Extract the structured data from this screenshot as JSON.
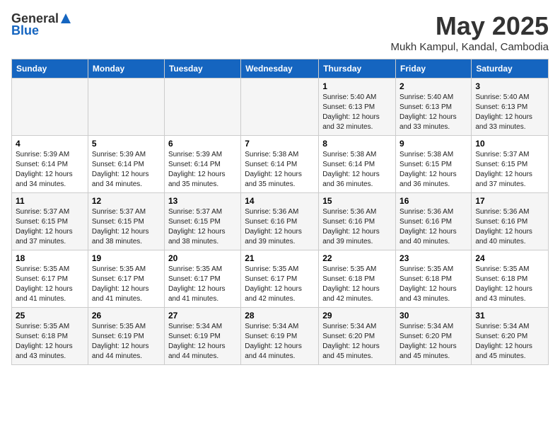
{
  "header": {
    "logo_general": "General",
    "logo_blue": "Blue",
    "month": "May 2025",
    "location": "Mukh Kampul, Kandal, Cambodia"
  },
  "weekdays": [
    "Sunday",
    "Monday",
    "Tuesday",
    "Wednesday",
    "Thursday",
    "Friday",
    "Saturday"
  ],
  "weeks": [
    [
      {
        "day": "",
        "sunrise": "",
        "sunset": "",
        "daylight": ""
      },
      {
        "day": "",
        "sunrise": "",
        "sunset": "",
        "daylight": ""
      },
      {
        "day": "",
        "sunrise": "",
        "sunset": "",
        "daylight": ""
      },
      {
        "day": "",
        "sunrise": "",
        "sunset": "",
        "daylight": ""
      },
      {
        "day": "1",
        "sunrise": "Sunrise: 5:40 AM",
        "sunset": "Sunset: 6:13 PM",
        "daylight": "Daylight: 12 hours and 32 minutes."
      },
      {
        "day": "2",
        "sunrise": "Sunrise: 5:40 AM",
        "sunset": "Sunset: 6:13 PM",
        "daylight": "Daylight: 12 hours and 33 minutes."
      },
      {
        "day": "3",
        "sunrise": "Sunrise: 5:40 AM",
        "sunset": "Sunset: 6:13 PM",
        "daylight": "Daylight: 12 hours and 33 minutes."
      }
    ],
    [
      {
        "day": "4",
        "sunrise": "Sunrise: 5:39 AM",
        "sunset": "Sunset: 6:14 PM",
        "daylight": "Daylight: 12 hours and 34 minutes."
      },
      {
        "day": "5",
        "sunrise": "Sunrise: 5:39 AM",
        "sunset": "Sunset: 6:14 PM",
        "daylight": "Daylight: 12 hours and 34 minutes."
      },
      {
        "day": "6",
        "sunrise": "Sunrise: 5:39 AM",
        "sunset": "Sunset: 6:14 PM",
        "daylight": "Daylight: 12 hours and 35 minutes."
      },
      {
        "day": "7",
        "sunrise": "Sunrise: 5:38 AM",
        "sunset": "Sunset: 6:14 PM",
        "daylight": "Daylight: 12 hours and 35 minutes."
      },
      {
        "day": "8",
        "sunrise": "Sunrise: 5:38 AM",
        "sunset": "Sunset: 6:14 PM",
        "daylight": "Daylight: 12 hours and 36 minutes."
      },
      {
        "day": "9",
        "sunrise": "Sunrise: 5:38 AM",
        "sunset": "Sunset: 6:15 PM",
        "daylight": "Daylight: 12 hours and 36 minutes."
      },
      {
        "day": "10",
        "sunrise": "Sunrise: 5:37 AM",
        "sunset": "Sunset: 6:15 PM",
        "daylight": "Daylight: 12 hours and 37 minutes."
      }
    ],
    [
      {
        "day": "11",
        "sunrise": "Sunrise: 5:37 AM",
        "sunset": "Sunset: 6:15 PM",
        "daylight": "Daylight: 12 hours and 37 minutes."
      },
      {
        "day": "12",
        "sunrise": "Sunrise: 5:37 AM",
        "sunset": "Sunset: 6:15 PM",
        "daylight": "Daylight: 12 hours and 38 minutes."
      },
      {
        "day": "13",
        "sunrise": "Sunrise: 5:37 AM",
        "sunset": "Sunset: 6:15 PM",
        "daylight": "Daylight: 12 hours and 38 minutes."
      },
      {
        "day": "14",
        "sunrise": "Sunrise: 5:36 AM",
        "sunset": "Sunset: 6:16 PM",
        "daylight": "Daylight: 12 hours and 39 minutes."
      },
      {
        "day": "15",
        "sunrise": "Sunrise: 5:36 AM",
        "sunset": "Sunset: 6:16 PM",
        "daylight": "Daylight: 12 hours and 39 minutes."
      },
      {
        "day": "16",
        "sunrise": "Sunrise: 5:36 AM",
        "sunset": "Sunset: 6:16 PM",
        "daylight": "Daylight: 12 hours and 40 minutes."
      },
      {
        "day": "17",
        "sunrise": "Sunrise: 5:36 AM",
        "sunset": "Sunset: 6:16 PM",
        "daylight": "Daylight: 12 hours and 40 minutes."
      }
    ],
    [
      {
        "day": "18",
        "sunrise": "Sunrise: 5:35 AM",
        "sunset": "Sunset: 6:17 PM",
        "daylight": "Daylight: 12 hours and 41 minutes."
      },
      {
        "day": "19",
        "sunrise": "Sunrise: 5:35 AM",
        "sunset": "Sunset: 6:17 PM",
        "daylight": "Daylight: 12 hours and 41 minutes."
      },
      {
        "day": "20",
        "sunrise": "Sunrise: 5:35 AM",
        "sunset": "Sunset: 6:17 PM",
        "daylight": "Daylight: 12 hours and 41 minutes."
      },
      {
        "day": "21",
        "sunrise": "Sunrise: 5:35 AM",
        "sunset": "Sunset: 6:17 PM",
        "daylight": "Daylight: 12 hours and 42 minutes."
      },
      {
        "day": "22",
        "sunrise": "Sunrise: 5:35 AM",
        "sunset": "Sunset: 6:18 PM",
        "daylight": "Daylight: 12 hours and 42 minutes."
      },
      {
        "day": "23",
        "sunrise": "Sunrise: 5:35 AM",
        "sunset": "Sunset: 6:18 PM",
        "daylight": "Daylight: 12 hours and 43 minutes."
      },
      {
        "day": "24",
        "sunrise": "Sunrise: 5:35 AM",
        "sunset": "Sunset: 6:18 PM",
        "daylight": "Daylight: 12 hours and 43 minutes."
      }
    ],
    [
      {
        "day": "25",
        "sunrise": "Sunrise: 5:35 AM",
        "sunset": "Sunset: 6:18 PM",
        "daylight": "Daylight: 12 hours and 43 minutes."
      },
      {
        "day": "26",
        "sunrise": "Sunrise: 5:35 AM",
        "sunset": "Sunset: 6:19 PM",
        "daylight": "Daylight: 12 hours and 44 minutes."
      },
      {
        "day": "27",
        "sunrise": "Sunrise: 5:34 AM",
        "sunset": "Sunset: 6:19 PM",
        "daylight": "Daylight: 12 hours and 44 minutes."
      },
      {
        "day": "28",
        "sunrise": "Sunrise: 5:34 AM",
        "sunset": "Sunset: 6:19 PM",
        "daylight": "Daylight: 12 hours and 44 minutes."
      },
      {
        "day": "29",
        "sunrise": "Sunrise: 5:34 AM",
        "sunset": "Sunset: 6:20 PM",
        "daylight": "Daylight: 12 hours and 45 minutes."
      },
      {
        "day": "30",
        "sunrise": "Sunrise: 5:34 AM",
        "sunset": "Sunset: 6:20 PM",
        "daylight": "Daylight: 12 hours and 45 minutes."
      },
      {
        "day": "31",
        "sunrise": "Sunrise: 5:34 AM",
        "sunset": "Sunset: 6:20 PM",
        "daylight": "Daylight: 12 hours and 45 minutes."
      }
    ]
  ]
}
